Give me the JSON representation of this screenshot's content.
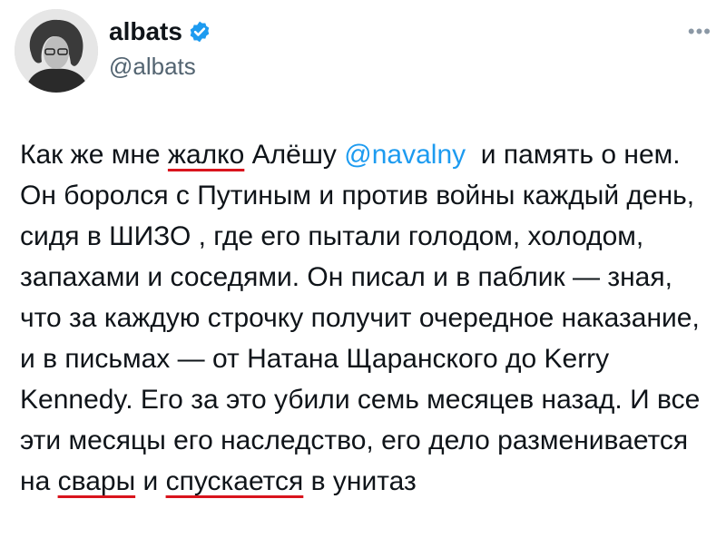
{
  "profile": {
    "display_name": "albats",
    "handle": "@albats",
    "verified_color": "#1d9bf0",
    "avatar_icon": "profile-photo-icon",
    "more_icon": "more-options-icon"
  },
  "tweet": {
    "segments": [
      {
        "text": "Как же мне ",
        "type": "text"
      },
      {
        "text": "жалко",
        "type": "underlined"
      },
      {
        "text": " Алёшу ",
        "type": "text"
      },
      {
        "text": "@navalny",
        "type": "mention"
      },
      {
        "text": "  и память о нем. Он боролся с Путиным и против войны каждый день, сидя в ШИЗО , где его пытали голодом, холодом, запахами и соседями. Он писал и в паблик — зная, что за каждую строчку получит очередное наказание, и в письмах — от Натана Щаранского до Kerry Kennedy. Его за это убили семь месяцев назад. И все эти месяцы его наследство, его дело разменивается на ",
        "type": "text"
      },
      {
        "text": "свары",
        "type": "underlined"
      },
      {
        "text": " и ",
        "type": "text"
      },
      {
        "text": "спускается",
        "type": "underlined"
      },
      {
        "text": " в унитаз",
        "type": "text"
      }
    ],
    "underline_color": "#d9141d",
    "mention_color": "#1d9bf0"
  }
}
